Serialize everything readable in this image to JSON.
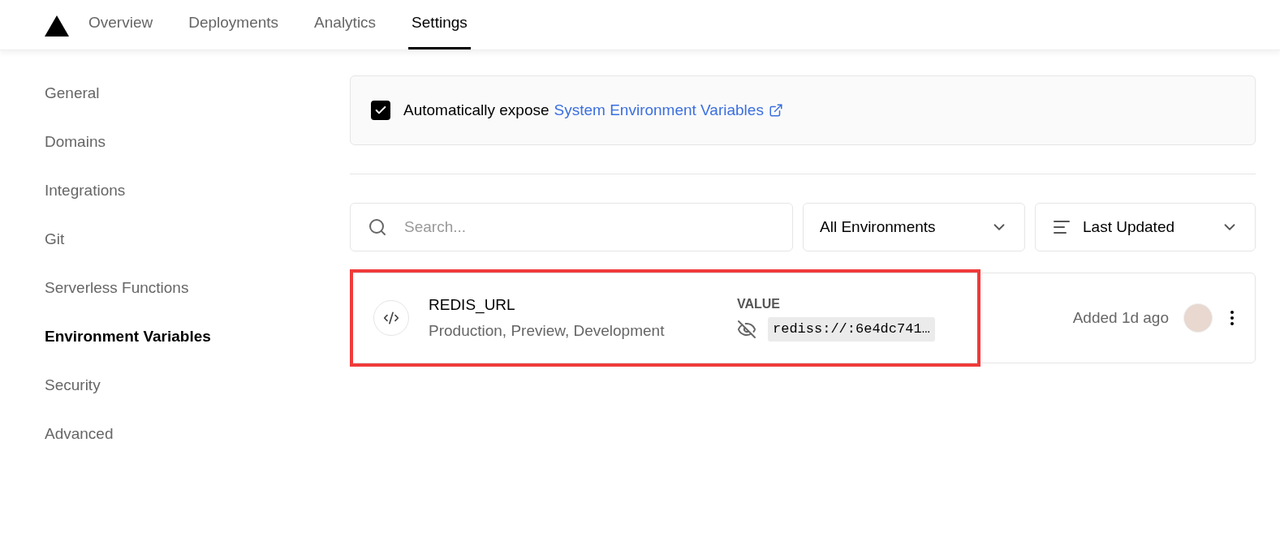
{
  "nav": {
    "tabs": [
      {
        "label": "Overview",
        "selected": false
      },
      {
        "label": "Deployments",
        "selected": false
      },
      {
        "label": "Analytics",
        "selected": false
      },
      {
        "label": "Settings",
        "selected": true
      }
    ]
  },
  "sidebar": {
    "items": [
      {
        "label": "General",
        "selected": false
      },
      {
        "label": "Domains",
        "selected": false
      },
      {
        "label": "Integrations",
        "selected": false
      },
      {
        "label": "Git",
        "selected": false
      },
      {
        "label": "Serverless Functions",
        "selected": false
      },
      {
        "label": "Environment Variables",
        "selected": true
      },
      {
        "label": "Security",
        "selected": false
      },
      {
        "label": "Advanced",
        "selected": false
      }
    ]
  },
  "expose": {
    "checked": true,
    "label": "Automatically expose",
    "link": "System Environment Variables"
  },
  "search": {
    "placeholder": "Search..."
  },
  "environment_filter": {
    "value": "All Environments"
  },
  "sort": {
    "value": "Last Updated"
  },
  "variables": [
    {
      "name": "REDIS_URL",
      "environments": "Production, Preview, Development",
      "value_label": "VALUE",
      "value": "rediss://:6e4dc741…",
      "highlighted": true,
      "added": "Added 1d ago"
    }
  ]
}
